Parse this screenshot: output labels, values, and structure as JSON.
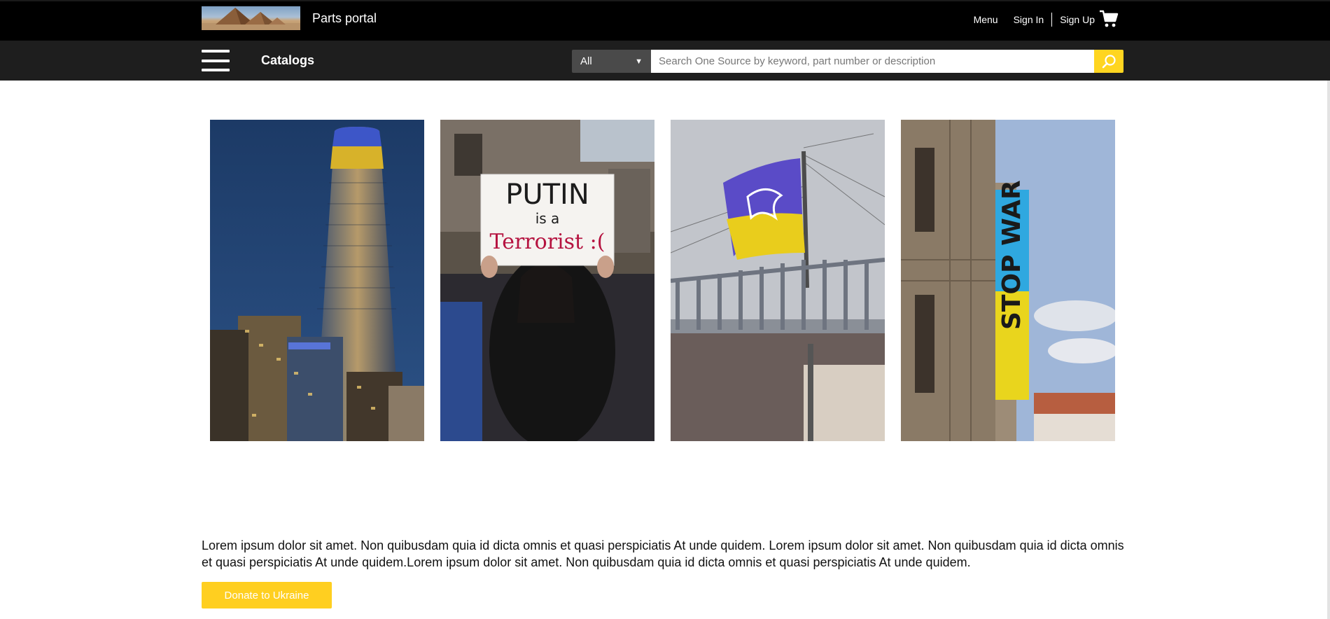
{
  "header": {
    "title": "Parts portal",
    "menu_label": "Menu",
    "sign_in_label": "Sign In",
    "sign_up_label": "Sign Up",
    "cart_icon": "shopping-cart-icon",
    "logo_icon": "pyramids-logo"
  },
  "navbar": {
    "menu_icon": "hamburger-menu-icon",
    "catalogs_label": "Catalogs",
    "search": {
      "category_selected": "All",
      "placeholder": "Search One Source by keyword, part number or description",
      "value": "",
      "button_icon": "search-icon"
    }
  },
  "gallery": {
    "images": [
      {
        "subject": "skyscraper-lit-blue-yellow"
      },
      {
        "subject": "protester-sign",
        "sign_line1": "PUTIN",
        "sign_line2": "is a",
        "sign_line3": "Terrorist :("
      },
      {
        "subject": "ukraine-flag-with-dove"
      },
      {
        "subject": "cathedral-banner",
        "banner_text": "STOP WAR"
      }
    ]
  },
  "content": {
    "body_text": "Lorem ipsum dolor sit amet. Non quibusdam quia id dicta omnis et quasi perspiciatis At unde quidem. Lorem ipsum dolor sit amet. Non quibusdam quia id dicta omnis et quasi perspiciatis At unde quidem.Lorem ipsum dolor sit amet. Non quibusdam quia id dicta omnis et quasi perspiciatis At unde quidem.",
    "donate_label": "Donate to Ukraine"
  },
  "colors": {
    "accent": "#ffcf20",
    "topbar": "#000000",
    "navbar": "#1e1e1e"
  }
}
